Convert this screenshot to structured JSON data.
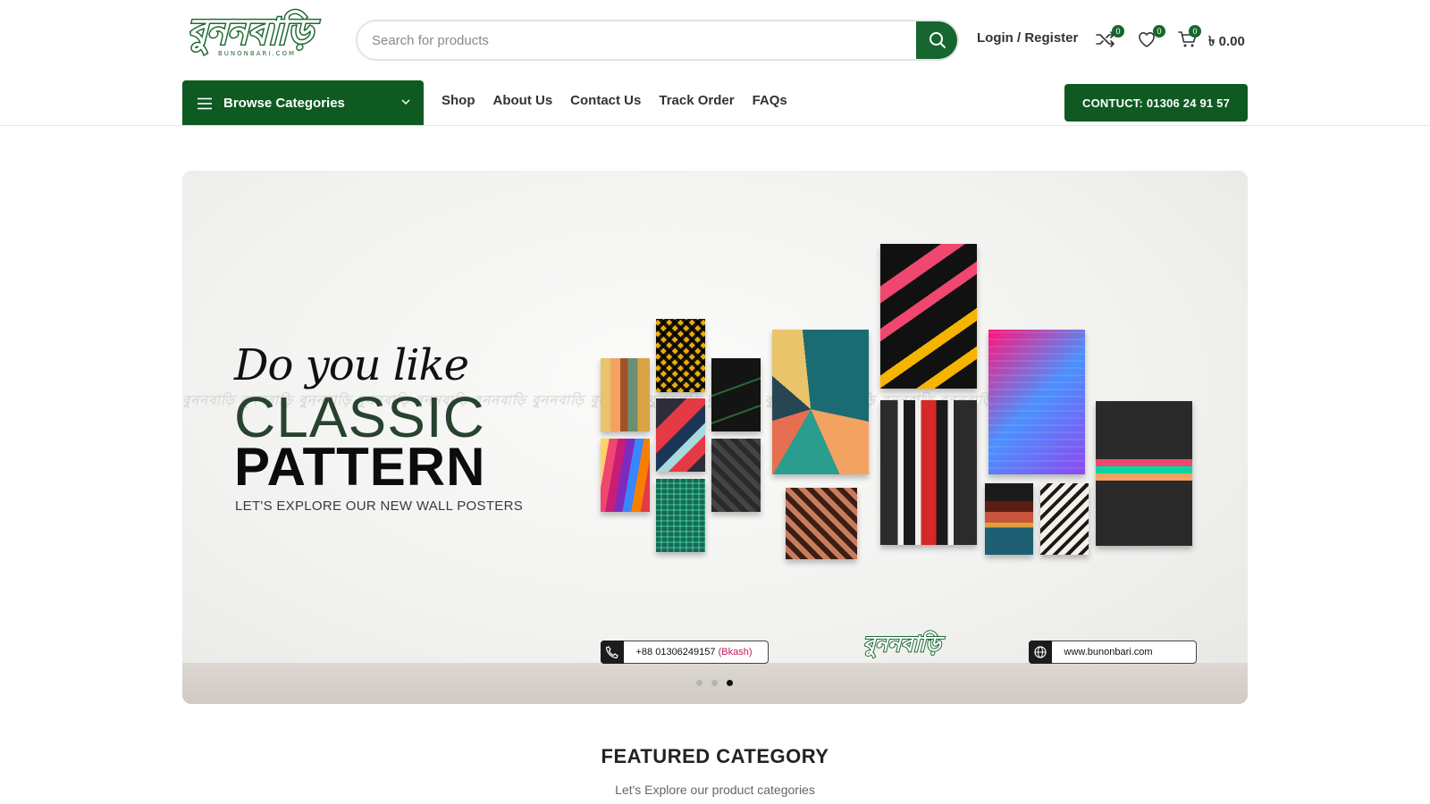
{
  "header": {
    "logo_text": "বুননবাড়ি",
    "logo_sub": "BUNONBARI.COM",
    "search_placeholder": "Search for products",
    "login_label": "Login / Register",
    "compare_count": "0",
    "wishlist_count": "0",
    "cart_count": "0",
    "cart_total": "৳ 0.00"
  },
  "nav": {
    "browse_label": "Browse Categories",
    "links": [
      "Shop",
      "About Us",
      "Contact Us",
      "Track Order",
      "FAQs"
    ],
    "contact_button": "CONTUCT: 01306 24 91 57"
  },
  "hero": {
    "script_text": "Do you like",
    "classic_text": "CLASSIC",
    "pattern_text": "PATTERN",
    "sub_text": "LET'S EXPLORE OUR NEW WALL POSTERS",
    "watermark": "বুননবাড়ি বুননবাড়ি বুননবাড়ি বুননবাড়ি বুননবাড়ি বুননবাড়ি বুননবাড়ি বুননবাড়ি বুননবাড়ি বুননবাড়ি বুননবাড়ি বুননবাড়ি বুননবাড়ি বুননবাড়ি",
    "phone_text": "+88 01306249157",
    "phone_note": "(Bkash)",
    "mini_logo": "বুননবাড়ি",
    "website": "www.bunonbari.com",
    "slide_count": 3,
    "active_slide": 3
  },
  "featured": {
    "title": "FEATURED CATEGORY",
    "subtitle": "Let's Explore our product categories"
  },
  "colors": {
    "brand_green": "#0e5a21",
    "accent_green": "#17662f"
  }
}
